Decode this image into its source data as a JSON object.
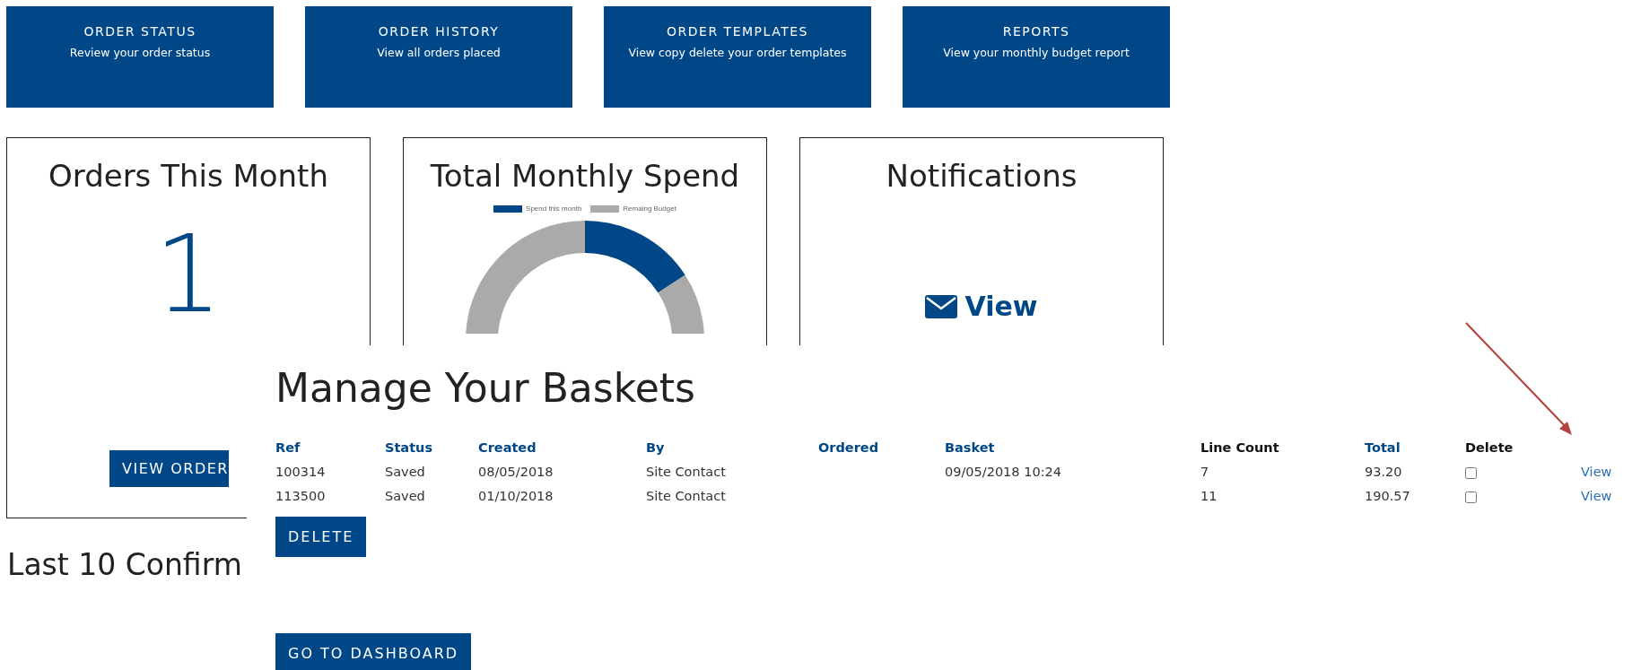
{
  "tiles": [
    {
      "title": "ORDER STATUS",
      "subtitle": "Review your order status"
    },
    {
      "title": "ORDER HISTORY",
      "subtitle": "View all orders placed"
    },
    {
      "title": "ORDER TEMPLATES",
      "subtitle": "View copy delete your order templates"
    },
    {
      "title": "REPORTS",
      "subtitle": "View your monthly budget report"
    }
  ],
  "cards": [
    {
      "kind": "count",
      "title": "Orders This Month",
      "value": "1",
      "button": "VIEW ORDER"
    },
    {
      "kind": "chart",
      "title": "Total Monthly Spend",
      "legend": [
        {
          "label": "Spend this month",
          "color": "#004787"
        },
        {
          "label": "Remaing Budget",
          "color": "#aaaaaa"
        }
      ]
    },
    {
      "kind": "link",
      "title": "Notifications",
      "link": "View"
    }
  ],
  "section_heading": "Last 10 Confirm",
  "baskets": {
    "title": "Manage Your Baskets",
    "columns": [
      {
        "label": "Ref",
        "sortable": true
      },
      {
        "label": "Status",
        "sortable": true
      },
      {
        "label": "Created",
        "sortable": true
      },
      {
        "label": "By",
        "sortable": true
      },
      {
        "label": "Ordered",
        "sortable": true
      },
      {
        "label": "Basket",
        "sortable": true
      },
      {
        "label": "Line Count",
        "sortable": false
      },
      {
        "label": "Total",
        "sortable": true
      },
      {
        "label": "Delete",
        "sortable": false
      }
    ],
    "rows": [
      {
        "cells": [
          "100314",
          "Saved",
          "08/05/2018",
          "Site Contact",
          null,
          "09/05/2018 10:24",
          "7",
          "93.20"
        ],
        "checked": false,
        "action": "View"
      },
      {
        "cells": [
          "113500",
          "Saved",
          "01/10/2018",
          "Site Contact",
          null,
          null,
          "11",
          "190.57"
        ],
        "checked": false,
        "action": "View"
      }
    ],
    "delete_button": "DELETE",
    "dashboard_button": "GO TO DASHBOARD"
  }
}
